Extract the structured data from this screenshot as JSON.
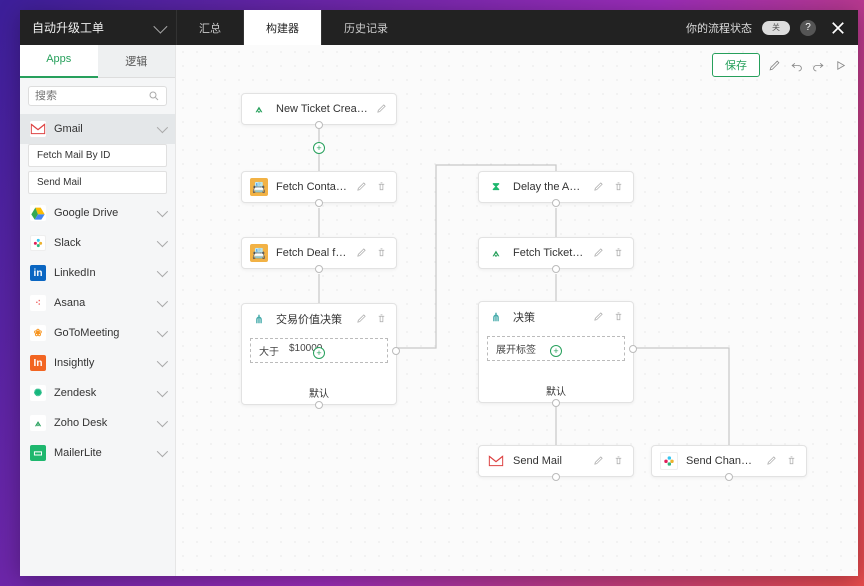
{
  "header": {
    "title": "自动升级工单",
    "tabs": [
      "汇总",
      "构建器",
      "历史记录"
    ],
    "activeTab": 1,
    "statusLabel": "你的流程状态",
    "toggleLabel": "关"
  },
  "sidebar": {
    "tabs": [
      "Apps",
      "逻辑"
    ],
    "activeTab": 0,
    "searchPlaceholder": "搜索",
    "apps": [
      {
        "name": "Gmail",
        "expanded": true,
        "icon": "gmail",
        "actions": [
          "Fetch Mail By ID",
          "Send Mail"
        ]
      },
      {
        "name": "Google Drive",
        "icon": "drive"
      },
      {
        "name": "Slack",
        "icon": "slack"
      },
      {
        "name": "LinkedIn",
        "icon": "linkedin"
      },
      {
        "name": "Asana",
        "icon": "asana"
      },
      {
        "name": "GoToMeeting",
        "icon": "gtm"
      },
      {
        "name": "Insightly",
        "icon": "insightly"
      },
      {
        "name": "Zendesk",
        "icon": "zendesk"
      },
      {
        "name": "Zoho Desk",
        "icon": "zoho"
      },
      {
        "name": "MailerLite",
        "icon": "ml"
      }
    ]
  },
  "toolbar": {
    "save": "保存"
  },
  "nodes": {
    "n1": {
      "title": "New Ticket Created in ..."
    },
    "n2": {
      "title": "Fetch Contact from CRM"
    },
    "n3": {
      "title": "Fetch Deal from CRM"
    },
    "n4": {
      "title": "交易价值决策",
      "optLabel": "大于",
      "optValue": "$10000",
      "default": "默认"
    },
    "n5": {
      "title": "Delay the Action"
    },
    "n6": {
      "title": "Fetch Ticket from Supp..."
    },
    "n7": {
      "title": "决策",
      "optLabel": "展开标签",
      "default": "默认"
    },
    "n8": {
      "title": "Send Mail"
    },
    "n9": {
      "title": "Send Channel Message"
    }
  }
}
